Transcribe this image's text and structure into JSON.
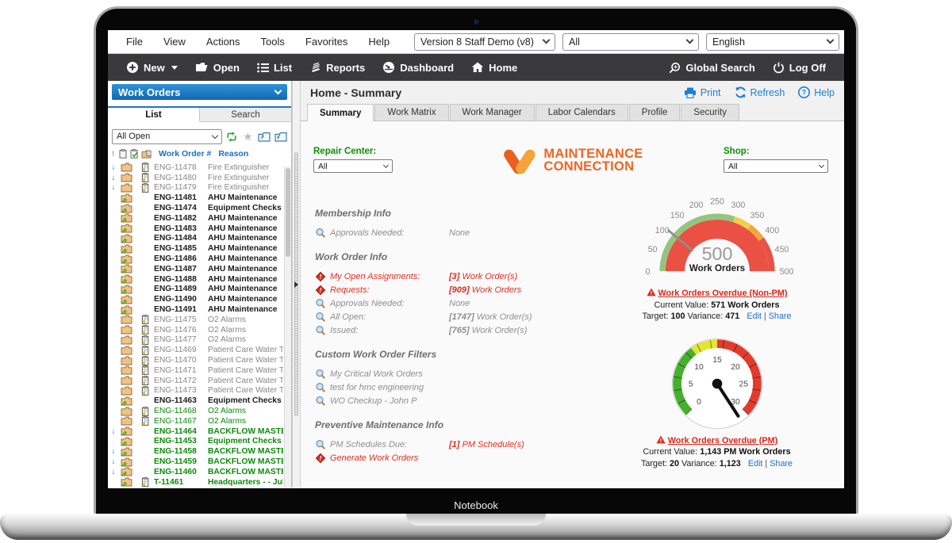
{
  "laptop": {
    "label": "Notebook"
  },
  "colors": {
    "accent_blue": "#1779c4",
    "toolbar_bg": "#3a3a3c",
    "green_label": "#089200",
    "alert_red": "#e02e22",
    "logo_orange": "#f26522",
    "gauge_green": "#94c57e",
    "gauge_yellow": "#f2ce4e",
    "gauge_orange": "#f2a93c",
    "gauge_red": "#ea5044",
    "dial_green": "#46b02e",
    "dial_yellow": "#e3e531",
    "dial_red": "#e23b2e"
  },
  "menu_bar": {
    "items": [
      "File",
      "View",
      "Actions",
      "Tools",
      "Favorites",
      "Help"
    ],
    "version_select": "Version 8 Staff Demo (v8)",
    "scope_select": "All",
    "language_select": "English"
  },
  "toolbar": {
    "new": "New",
    "open": "Open",
    "list": "List",
    "reports": "Reports",
    "dashboard": "Dashboard",
    "home": "Home",
    "global_search": "Global Search",
    "log_off": "Log Off"
  },
  "sidebar": {
    "module": "Work Orders",
    "tab_list": "List",
    "tab_search": "Search",
    "filter_value": "All Open",
    "col_wo": "Work Order #",
    "col_reason": "Reason",
    "header_flag": "!",
    "rows": [
      {
        "wo": "ENG-11478",
        "reason": "Fire Extinguisher",
        "class": "dim",
        "arrow": true,
        "doc": true
      },
      {
        "wo": "ENG-11480",
        "reason": "Fire Extinguisher",
        "class": "dim",
        "arrow": true,
        "doc": true
      },
      {
        "wo": "ENG-11479",
        "reason": "Fire Extinguisher",
        "class": "dim",
        "arrow": true,
        "doc": true
      },
      {
        "wo": "ENG-11481",
        "reason": "AHU Maintenance",
        "class": "bold"
      },
      {
        "wo": "ENG-11474",
        "reason": "Equipment Checks",
        "class": "bold"
      },
      {
        "wo": "ENG-11482",
        "reason": "AHU Maintenance",
        "class": "bold"
      },
      {
        "wo": "ENG-11483",
        "reason": "AHU Maintenance",
        "class": "bold"
      },
      {
        "wo": "ENG-11484",
        "reason": "AHU Maintenance",
        "class": "bold"
      },
      {
        "wo": "ENG-11485",
        "reason": "AHU Maintenance",
        "class": "bold"
      },
      {
        "wo": "ENG-11486",
        "reason": "AHU Maintenance",
        "class": "bold"
      },
      {
        "wo": "ENG-11487",
        "reason": "AHU Maintenance",
        "class": "bold"
      },
      {
        "wo": "ENG-11488",
        "reason": "AHU Maintenance",
        "class": "bold"
      },
      {
        "wo": "ENG-11489",
        "reason": "AHU Maintenance",
        "class": "bold"
      },
      {
        "wo": "ENG-11490",
        "reason": "AHU Maintenance",
        "class": "bold"
      },
      {
        "wo": "ENG-11491",
        "reason": "AHU Maintenance",
        "class": "bold"
      },
      {
        "wo": "ENG-11475",
        "reason": "O2 Alarms",
        "class": "dim",
        "doc": true
      },
      {
        "wo": "ENG-11476",
        "reason": "O2 Alarms",
        "class": "dim",
        "doc": true
      },
      {
        "wo": "ENG-11477",
        "reason": "O2 Alarms",
        "class": "dim",
        "doc": true
      },
      {
        "wo": "ENG-11469",
        "reason": "Patient Care Water Tem",
        "class": "dim",
        "doc": true
      },
      {
        "wo": "ENG-11470",
        "reason": "Patient Care Water Tem",
        "class": "dim",
        "doc": true
      },
      {
        "wo": "ENG-11471",
        "reason": "Patient Care Water Tem",
        "class": "dim",
        "doc": true
      },
      {
        "wo": "ENG-11472",
        "reason": "Patient Care Water Tem",
        "class": "dim",
        "doc": true
      },
      {
        "wo": "ENG-11473",
        "reason": "Patient Care Water Tem",
        "class": "dim",
        "doc": true
      },
      {
        "wo": "ENG-11463",
        "reason": "Equipment Checks",
        "class": "bold"
      },
      {
        "wo": "ENG-11468",
        "reason": "O2 Alarms",
        "class": "green",
        "doc": true
      },
      {
        "wo": "ENG-11467",
        "reason": "O2 Alarms",
        "class": "green",
        "doc": true
      },
      {
        "wo": "ENG-11464",
        "reason": "BACKFLOW MASTER",
        "class": "greenbold",
        "arrow": true
      },
      {
        "wo": "ENG-11453",
        "reason": "Equipment Checks",
        "class": "greenbold"
      },
      {
        "wo": "ENG-11458",
        "reason": "BACKFLOW MASTER",
        "class": "greenbold",
        "arrow": true
      },
      {
        "wo": "ENG-11459",
        "reason": "BACKFLOW MASTER",
        "class": "greenbold",
        "arrow": true
      },
      {
        "wo": "ENG-11460",
        "reason": "BACKFLOW MASTER",
        "class": "greenbold",
        "arrow": true
      },
      {
        "wo": "T-11461",
        "reason": "Headquarters - - Jul ..",
        "class": "greenbold",
        "doc": true
      }
    ]
  },
  "main": {
    "title": "Home - Summary",
    "print": "Print",
    "refresh": "Refresh",
    "help": "Help",
    "tabs": [
      "Summary",
      "Work Matrix",
      "Work Manager",
      "Labor Calendars",
      "Profile",
      "Security"
    ],
    "repair_center_label": "Repair Center:",
    "repair_center_value": "All",
    "shop_label": "Shop:",
    "shop_value": "All",
    "logo_line1": "MAINTENANCE",
    "logo_line2": "CONNECTION",
    "sections": [
      {
        "title": "Membership Info",
        "items": [
          {
            "search": true,
            "label": "Approvals Needed:",
            "vnum": "",
            "vrest": "None"
          }
        ]
      },
      {
        "title": "Work Order Info",
        "items": [
          {
            "alert": true,
            "label": "My Open Assignments:",
            "vnum": "[3]",
            "vrest": " Work Order(s)",
            "class": "red"
          },
          {
            "alert": true,
            "label": "Requests:",
            "vnum": "[909]",
            "vrest": " Work Orders",
            "class": "red"
          },
          {
            "search": true,
            "label": "Approvals Needed:",
            "vnum": "",
            "vrest": "None"
          },
          {
            "search": true,
            "label": "All Open:",
            "vnum": "[1747]",
            "vrest": " Work Order(s)"
          },
          {
            "search": true,
            "label": "Issued:",
            "vnum": "[765]",
            "vrest": " Work Order(s)"
          }
        ]
      },
      {
        "title": "Custom Work Order Filters",
        "items": [
          {
            "search": true,
            "label": "My Critical Work Orders",
            "vnum": "",
            "vrest": ""
          },
          {
            "search": true,
            "label": "test for hmc engineering",
            "vnum": "",
            "vrest": ""
          },
          {
            "search": true,
            "label": "WO Checkup - John P",
            "vnum": "",
            "vrest": ""
          }
        ]
      },
      {
        "title": "Preventive Maintenance Info",
        "items": [
          {
            "search": true,
            "label": "PM Schedules Due:",
            "vnum": "[1]",
            "vrest": " PM Schedule(s)",
            "class": "redval"
          },
          {
            "alert": true,
            "label": "Generate Work Orders",
            "vnum": "",
            "vrest": "",
            "class": "red"
          }
        ]
      }
    ],
    "gauges": [
      {
        "ticks": [
          "0",
          "50",
          "100",
          "150",
          "200",
          "250",
          "300",
          "350",
          "400",
          "450",
          "500"
        ],
        "center_value": "500",
        "center_label": "Work Orders",
        "title": "Work Orders Overdue (Non-PM)",
        "current_label": "Current Value:",
        "current_value": "571 Work Orders",
        "target_label": "Target:",
        "target_value": "100",
        "variance_label": "Variance:",
        "variance_value": "471",
        "edit": "Edit",
        "share": "Share",
        "link_sep": "|"
      },
      {
        "ticks": [
          "0",
          "5",
          "10",
          "15",
          "20",
          "25",
          "30"
        ],
        "title": "Work Orders Overdue (PM)",
        "current_label": "Current Value:",
        "current_value": "1,143 PM Work Orders",
        "target_label": "Target:",
        "target_value": "20",
        "variance_label": "Variance:",
        "variance_value": "1,123",
        "edit": "Edit",
        "share": "Share",
        "link_sep": "|"
      }
    ]
  }
}
